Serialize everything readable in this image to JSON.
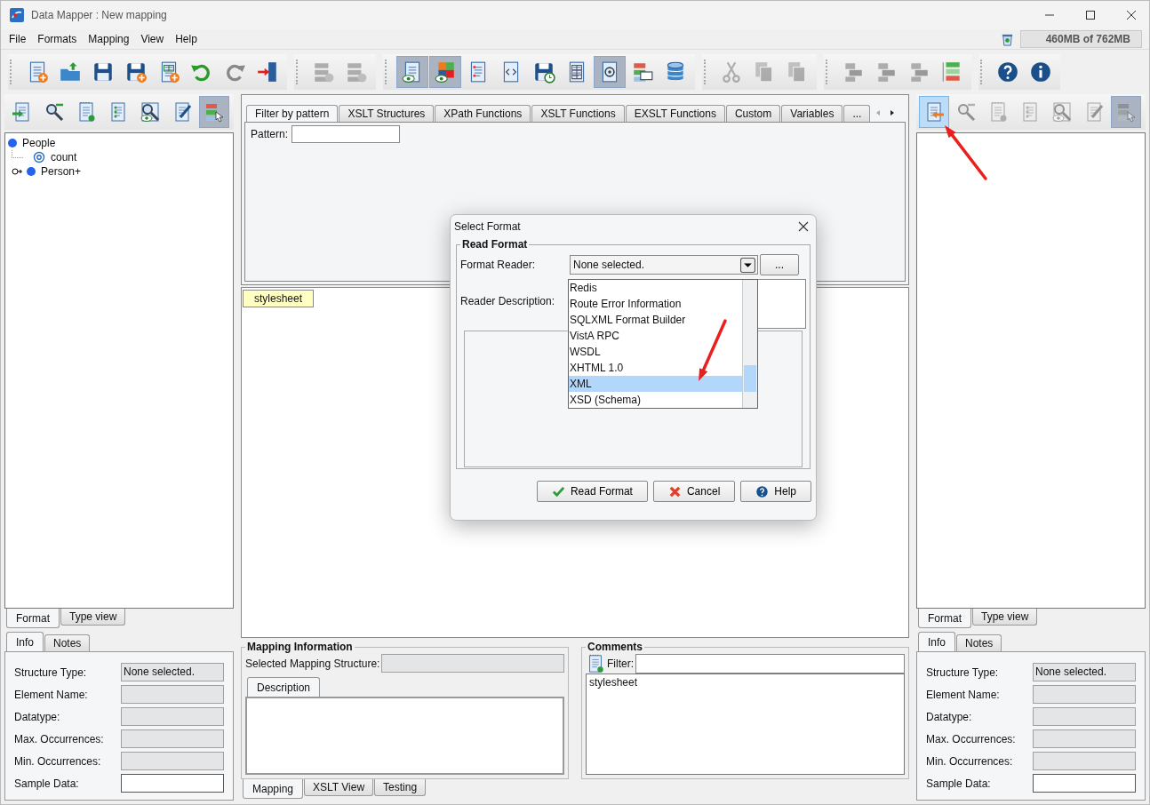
{
  "window": {
    "title": "Data Mapper : New mapping"
  },
  "menu": [
    "File",
    "Formats",
    "Mapping",
    "View",
    "Help"
  ],
  "memory": {
    "text": "460MB of 762MB"
  },
  "toolbar": {
    "groups": [
      {
        "items": [
          {
            "kind": "newdoc",
            "pressed": false,
            "disabled": false
          },
          {
            "kind": "folder",
            "pressed": false,
            "disabled": false
          },
          {
            "kind": "floppy",
            "pressed": false,
            "disabled": false
          },
          {
            "kind": "floppyplus",
            "pressed": false,
            "disabled": false
          },
          {
            "kind": "sheet",
            "pressed": false,
            "disabled": false
          },
          {
            "kind": "undo",
            "pressed": false,
            "disabled": false
          },
          {
            "kind": "redo",
            "pressed": false,
            "disabled": false
          },
          {
            "kind": "door",
            "pressed": false,
            "disabled": false
          }
        ]
      },
      {
        "items": [
          {
            "kind": "server",
            "pressed": false,
            "disabled": true
          },
          {
            "kind": "server",
            "pressed": false,
            "disabled": true
          }
        ]
      },
      {
        "items": [
          {
            "kind": "eyedoc",
            "pressed": true,
            "disabled": false
          },
          {
            "kind": "eyegrid",
            "pressed": true,
            "disabled": false
          },
          {
            "kind": "checklist",
            "pressed": false,
            "disabled": false
          },
          {
            "kind": "code",
            "pressed": false,
            "disabled": false
          },
          {
            "kind": "clock",
            "pressed": false,
            "disabled": false
          },
          {
            "kind": "table",
            "pressed": false,
            "disabled": false
          },
          {
            "kind": "at",
            "pressed": true,
            "disabled": false
          },
          {
            "kind": "tree",
            "pressed": false,
            "disabled": false
          },
          {
            "kind": "database",
            "pressed": false,
            "disabled": false
          }
        ]
      },
      {
        "items": [
          {
            "kind": "scissors",
            "pressed": false,
            "disabled": true
          },
          {
            "kind": "copy",
            "pressed": false,
            "disabled": true
          },
          {
            "kind": "copy",
            "pressed": false,
            "disabled": true
          }
        ]
      },
      {
        "items": [
          {
            "kind": "blocks",
            "pressed": false,
            "disabled": true
          },
          {
            "kind": "blocks",
            "pressed": false,
            "disabled": true
          },
          {
            "kind": "blocks",
            "pressed": false,
            "disabled": true
          },
          {
            "kind": "stack",
            "pressed": false,
            "disabled": false
          }
        ]
      },
      {
        "items": [
          {
            "kind": "help",
            "pressed": false,
            "disabled": false
          },
          {
            "kind": "info",
            "pressed": false,
            "disabled": false
          }
        ]
      }
    ]
  },
  "left_panel": {
    "toolbar": [
      {
        "kind": "import",
        "pressed": false,
        "disabled": false
      },
      {
        "kind": "magnifier",
        "pressed": false,
        "disabled": false
      },
      {
        "kind": "notepad",
        "pressed": false,
        "disabled": false
      },
      {
        "kind": "list",
        "pressed": false,
        "disabled": false
      },
      {
        "kind": "zoomeye",
        "pressed": false,
        "disabled": false
      },
      {
        "kind": "pencil",
        "pressed": false,
        "disabled": false
      },
      {
        "kind": "treecursor",
        "pressed": true,
        "disabled": false
      }
    ],
    "tree": [
      {
        "label": "People",
        "kind": "element",
        "children": [
          {
            "label": "count",
            "kind": "attribute"
          },
          {
            "label": "Person+",
            "kind": "element",
            "expanded": false
          }
        ]
      }
    ],
    "view_tabs": [
      {
        "label": "Format",
        "selected": true
      },
      {
        "label": "Type view",
        "selected": false
      }
    ],
    "info_tabs": [
      {
        "label": "Info",
        "selected": true
      },
      {
        "label": "Notes",
        "selected": false
      }
    ],
    "fields": [
      {
        "label": "Structure Type:",
        "value": "None selected.",
        "editable": false
      },
      {
        "label": "Element Name:",
        "editable": false
      },
      {
        "label": "Datatype:",
        "editable": false
      },
      {
        "label": "Max. Occurrences:",
        "editable": false
      },
      {
        "label": "Min. Occurrences:",
        "editable": false
      },
      {
        "label": "Sample Data:",
        "editable": true
      }
    ]
  },
  "center": {
    "palette_tabs": [
      {
        "label": "Filter by pattern",
        "selected": true
      },
      {
        "label": "XSLT Structures",
        "selected": false
      },
      {
        "label": "XPath Functions",
        "selected": false
      },
      {
        "label": "XSLT Functions",
        "selected": false
      },
      {
        "label": "EXSLT Functions",
        "selected": false
      },
      {
        "label": "Custom",
        "selected": false
      },
      {
        "label": "Variables",
        "selected": false
      },
      {
        "label": "...",
        "selected": false
      }
    ],
    "pattern_label": "Pattern:",
    "canvas_nodes": [
      {
        "label": "stylesheet"
      }
    ],
    "mapping_information": {
      "title": "Mapping Information",
      "structure_label": "Selected Mapping Structure:",
      "tabs": [
        {
          "label": "Description",
          "selected": true
        }
      ]
    },
    "comments": {
      "title": "Comments",
      "filter_label": "Filter:",
      "items": [
        "stylesheet"
      ]
    },
    "bottom_tabs": [
      {
        "label": "Mapping",
        "selected": true
      },
      {
        "label": "XSLT View",
        "selected": false
      },
      {
        "label": "Testing",
        "selected": false
      }
    ]
  },
  "right_panel": {
    "toolbar": [
      {
        "kind": "export",
        "pressed": true,
        "disabled": false
      },
      {
        "kind": "magnifier",
        "pressed": false,
        "disabled": true
      },
      {
        "kind": "notepad",
        "pressed": false,
        "disabled": true
      },
      {
        "kind": "list",
        "pressed": false,
        "disabled": true
      },
      {
        "kind": "zoomeye",
        "pressed": false,
        "disabled": true
      },
      {
        "kind": "pencil",
        "pressed": false,
        "disabled": true
      },
      {
        "kind": "treecursor",
        "pressed": true,
        "disabled": true
      }
    ],
    "view_tabs": [
      {
        "label": "Format",
        "selected": true
      },
      {
        "label": "Type view",
        "selected": false
      }
    ],
    "info_tabs": [
      {
        "label": "Info",
        "selected": true
      },
      {
        "label": "Notes",
        "selected": false
      }
    ],
    "fields": [
      {
        "label": "Structure Type:",
        "value": "None selected.",
        "editable": false
      },
      {
        "label": "Element Name:",
        "editable": false
      },
      {
        "label": "Datatype:",
        "editable": false
      },
      {
        "label": "Max. Occurrences:",
        "editable": false
      },
      {
        "label": "Min. Occurrences:",
        "editable": false
      },
      {
        "label": "Sample Data:",
        "editable": true
      }
    ]
  },
  "dialog": {
    "title": "Select Format",
    "group_title": "Read Format",
    "reader_label": "Format Reader:",
    "reader_value": "None selected.",
    "browse_button": "...",
    "description_label": "Reader Description:",
    "options": [
      {
        "label": "Redis",
        "selected": false
      },
      {
        "label": "Route Error Information",
        "selected": false
      },
      {
        "label": "SQLXML Format Builder",
        "selected": false
      },
      {
        "label": "VistA RPC",
        "selected": false
      },
      {
        "label": "WSDL",
        "selected": false
      },
      {
        "label": "XHTML 1.0",
        "selected": false
      },
      {
        "label": "XML",
        "selected": true
      },
      {
        "label": "XSD (Schema)",
        "selected": false
      }
    ],
    "buttons": [
      {
        "label": "Read Format",
        "kind": "confirm"
      },
      {
        "label": "Cancel",
        "kind": "cancel"
      },
      {
        "label": "Help",
        "kind": "help"
      }
    ]
  }
}
